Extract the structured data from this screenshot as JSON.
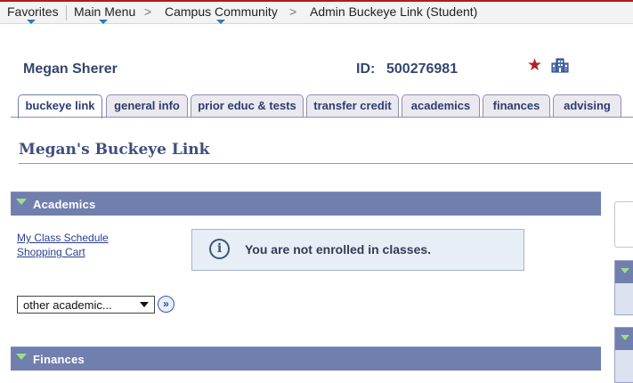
{
  "menu": {
    "favorites": "Favorites",
    "main_menu": "Main Menu",
    "campus_community": "Campus Community",
    "breadcrumb_current": "Admin Buckeye Link (Student)",
    "separator": ">"
  },
  "student": {
    "name": "Megan Sherer",
    "id_label": "ID:",
    "id_value": "500276981"
  },
  "tabs": [
    {
      "label": "buckeye link",
      "active": true
    },
    {
      "label": "general info"
    },
    {
      "label": "prior educ & tests"
    },
    {
      "label": "transfer credit"
    },
    {
      "label": "academics"
    },
    {
      "label": "finances"
    },
    {
      "label": "advising"
    }
  ],
  "page": {
    "title": "Megan's Buckeye Link"
  },
  "academics": {
    "header": "Academics",
    "links": [
      "My Class Schedule",
      "Shopping Cart"
    ],
    "info_icon": "i",
    "message": "You are not enrolled in classes.",
    "select_value": "other academic...",
    "go_label": "»"
  },
  "finances": {
    "header": "Finances"
  },
  "icons": {
    "star": "★",
    "favorites_dropdown": "triangle-down-icon",
    "building": "building-icon"
  },
  "colors": {
    "accent_red": "#b31b1b",
    "section_header": "#707fae",
    "tab_text": "#2e3b6f",
    "toggle_green": "#9be087"
  }
}
